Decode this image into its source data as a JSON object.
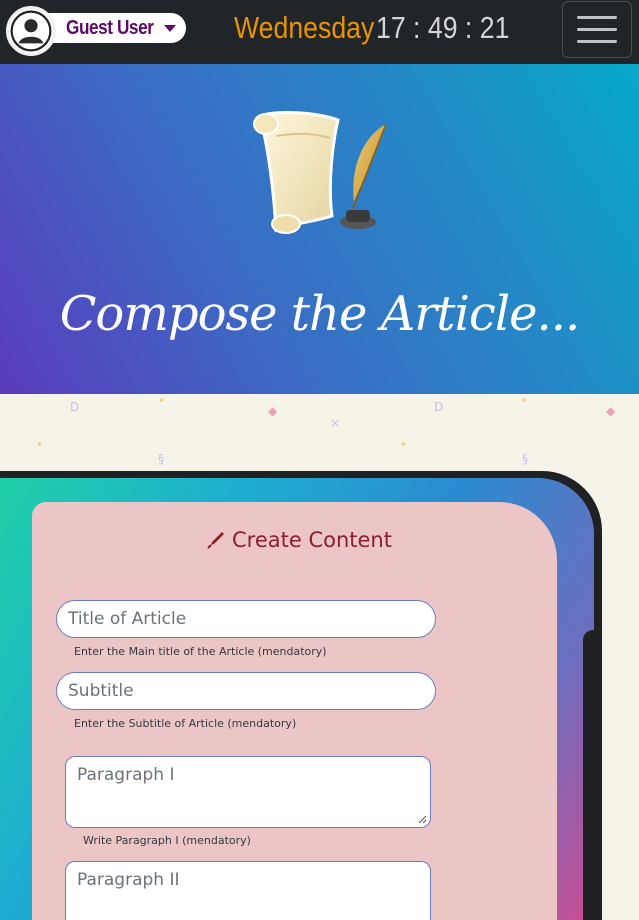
{
  "header": {
    "user_name": "Guest User",
    "day": "Wednesday",
    "time": "17 : 49 : 21"
  },
  "hero": {
    "title": "Compose the Article..."
  },
  "form": {
    "heading": "Create Content",
    "title_placeholder": "Title of Article",
    "title_hint": "Enter the Main title of the Article (mendatory)",
    "subtitle_placeholder": "Subtitle",
    "subtitle_hint": "Enter the Subtitle of Article (mendatory)",
    "paragraph1_placeholder": "Paragraph I",
    "paragraph1_hint": "Write Paragraph I (mendatory)",
    "paragraph2_placeholder": "Paragraph II"
  },
  "colors": {
    "topbar": "#212529",
    "day": "#e69500",
    "user_name": "#5d0b66",
    "heading": "#8b1f2a",
    "panel": "#ecc6c6"
  },
  "icons": [
    "user-avatar-icon",
    "caret-down-icon",
    "hamburger-menu-icon",
    "scroll-quill-icon",
    "pen-icon",
    "resize-handle-icon"
  ]
}
